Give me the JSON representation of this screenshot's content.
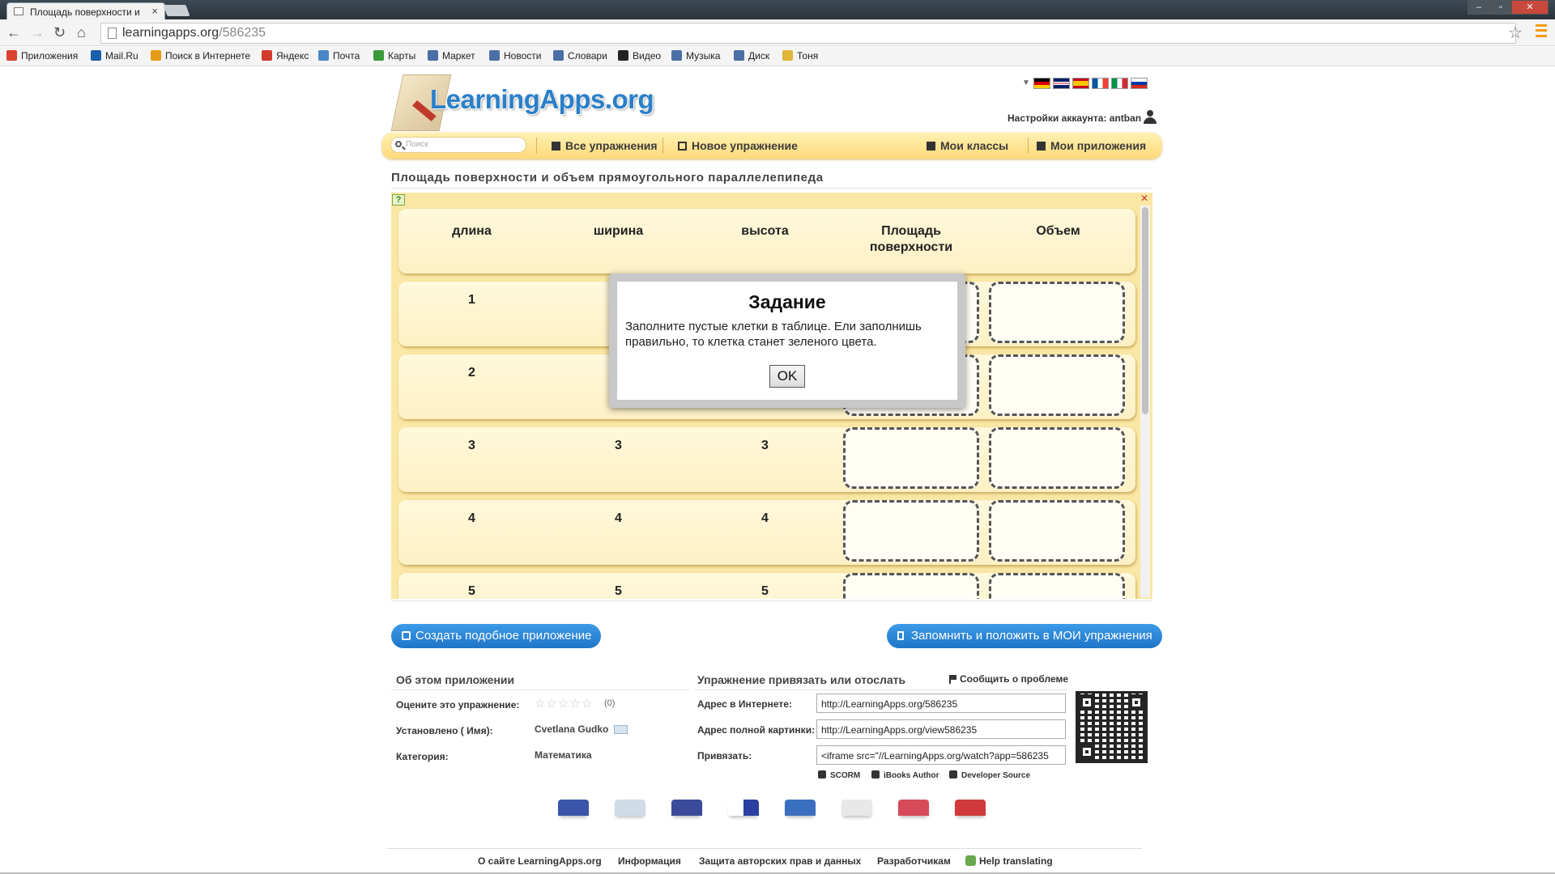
{
  "browser": {
    "tab_title": "Площадь поверхности и",
    "tab_close": "×",
    "url_host": "learningapps.org",
    "url_path": "/586235",
    "window_controls": [
      "–",
      "▫",
      "✕"
    ],
    "bookmarks": [
      {
        "label": "Приложения",
        "icon": "apps-grid-icon",
        "color": "#d9432f"
      },
      {
        "label": "Mail.Ru",
        "icon": "mailru-icon",
        "color": "#1a5fa8"
      },
      {
        "label": "Поиск в Интернете",
        "icon": "search-web-icon",
        "color": "#e69b16"
      },
      {
        "label": "Яндекс",
        "icon": "yandex-icon",
        "color": "#d23a2c"
      },
      {
        "label": "Почта",
        "icon": "mail-icon",
        "color": "#4a86c8"
      },
      {
        "label": "Карты",
        "icon": "maps-icon",
        "color": "#3a9a3a"
      },
      {
        "label": "Маркет",
        "icon": "market-icon",
        "color": "#4a6fa5"
      },
      {
        "label": "Новости",
        "icon": "news-icon",
        "color": "#4a6fa5"
      },
      {
        "label": "Словари",
        "icon": "dictionary-icon",
        "color": "#4a6fa5"
      },
      {
        "label": "Видео",
        "icon": "video-play-icon",
        "color": "#222222"
      },
      {
        "label": "Музыка",
        "icon": "music-icon",
        "color": "#4a6fa5"
      },
      {
        "label": "Диск",
        "icon": "disk-icon",
        "color": "#4a6fa5"
      },
      {
        "label": "Тоня",
        "icon": "folder-icon",
        "color": "#e0b63a"
      }
    ]
  },
  "site": {
    "logo": "LearningApps.org",
    "account": "Настройки аккаунта: antban",
    "flags": [
      [
        "#000000",
        "#dd0000",
        "#ffce00"
      ],
      [
        "#012169",
        "#ffffff",
        "#c8102e"
      ],
      [
        "#c60b1e",
        "#ffc400",
        "#c60b1e"
      ],
      [
        "#0055a4",
        "#ffffff",
        "#ef4135"
      ],
      [
        "#009246",
        "#ffffff",
        "#ce2b37"
      ],
      [
        "#ffffff",
        "#0039a6",
        "#d52b1e"
      ]
    ],
    "nav": {
      "search_placeholder": "Поиск",
      "all_exercises": "Все упражнения",
      "new_exercise": "Новое упражнение",
      "my_classes": "Мои классы",
      "my_apps": "Мои приложения"
    },
    "page_title": "Площадь поверхности и объем прямоугольного параллелепипеда"
  },
  "exercise": {
    "columns": [
      "длина",
      "ширина",
      "высота",
      "Площадь поверхности",
      "Объем"
    ],
    "rows": [
      [
        "1",
        "",
        ""
      ],
      [
        "2",
        "",
        ""
      ],
      [
        "3",
        "3",
        "3"
      ],
      [
        "4",
        "4",
        "4"
      ],
      [
        "5",
        "5",
        "5"
      ]
    ],
    "help_glyph": "?",
    "fullscreen_glyph": "✕"
  },
  "modal": {
    "title": "Задание",
    "text": "Заполните пустые клетки в таблице. Ели заполнишь правильно, то клетка станет зеленого цвета.",
    "ok": "OK"
  },
  "actions": {
    "create_similar": "Создать подобное приложение",
    "save_to_mine": "Запомнить и положить в МОИ упражнения"
  },
  "about": {
    "heading": "Об этом приложении",
    "rate_label": "Оцените это упражнение:",
    "stars": "☆☆☆☆☆",
    "rating_count": "(0)",
    "author_label": "Установлено ( Имя):",
    "author": "Cvetlana Gudko",
    "category_label": "Категория:",
    "category": "Математика"
  },
  "embed": {
    "heading": "Упражнение привязать или отослать",
    "report": "Сообщить о проблеме",
    "url_label": "Адрес в Интернете:",
    "url_value": "http://LearningApps.org/586235",
    "full_label": "Адрес полной картинки:",
    "full_value": "http://LearningApps.org/view586235",
    "embed_label": "Привязать:",
    "embed_value": "<iframe src=\"//LearningApps.org/watch?app=586235",
    "exports": [
      "SCORM",
      "iBooks Author",
      "Developer Source"
    ]
  },
  "share": [
    {
      "icon": "email-share-icon",
      "color": "#3b55a8"
    },
    {
      "icon": "twitter-share-icon",
      "color": "#cfdbe6"
    },
    {
      "icon": "facebook-share-icon",
      "color": "#3b4a9a"
    },
    {
      "icon": "delicious-share-icon",
      "color": "#2a3fa0"
    },
    {
      "icon": "myspace-share-icon",
      "color": "#3a6fc0"
    },
    {
      "icon": "google-share-icon",
      "color": "#e8e8e8"
    },
    {
      "icon": "pinterest-share-icon",
      "color": "#d64a5a"
    },
    {
      "icon": "google-plus-share-icon",
      "color": "#d03a3a"
    }
  ],
  "footer": {
    "about": "О сайте LearningApps.org",
    "info": "Информация",
    "privacy": "Защита авторских прав и данных",
    "developers": "Разработчикам",
    "help_translating": "Help translating"
  }
}
